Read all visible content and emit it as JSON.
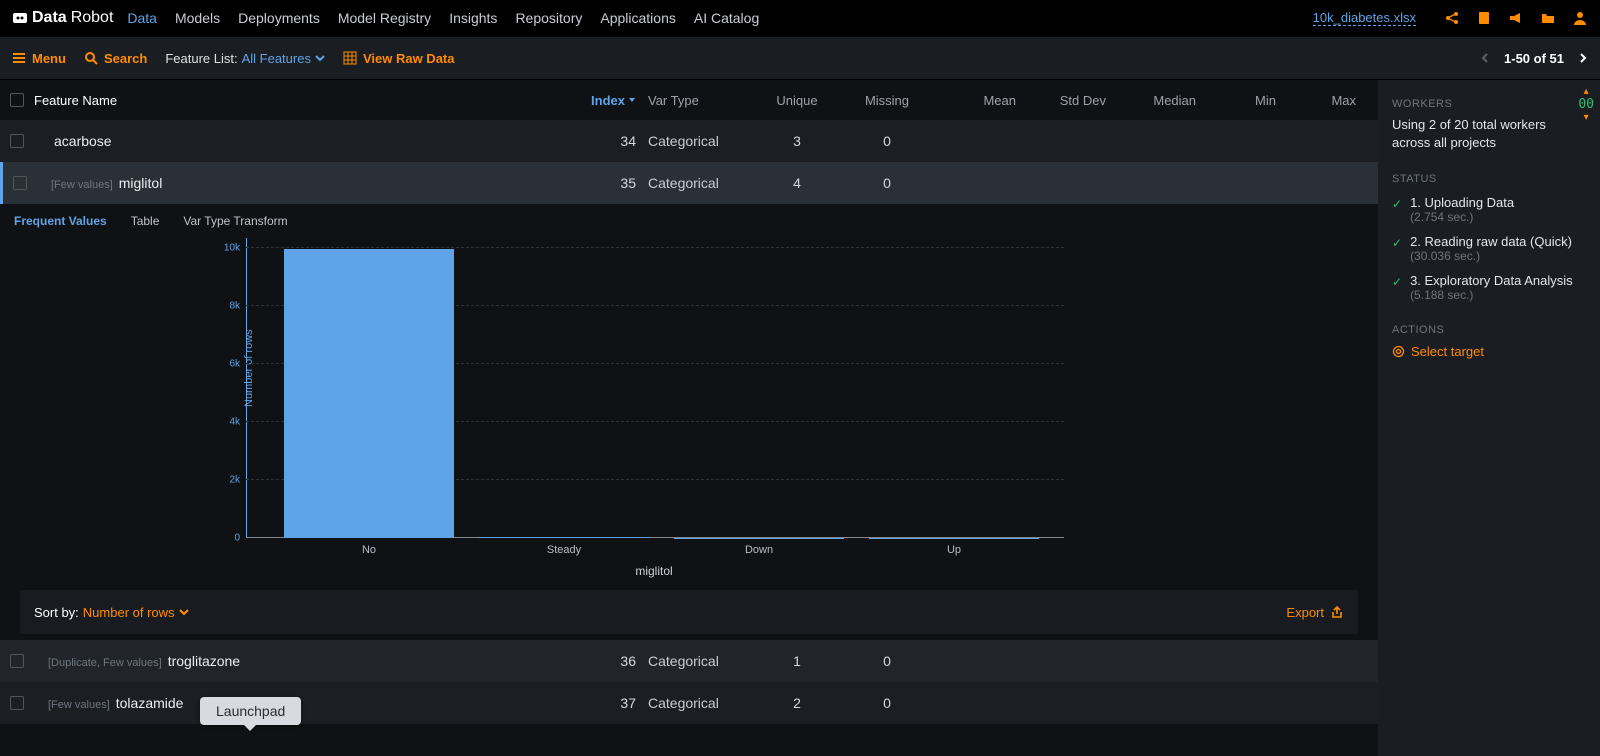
{
  "topnav": {
    "logo_bold": "Data",
    "logo_thin": "Robot",
    "items": [
      "Data",
      "Models",
      "Deployments",
      "Model Registry",
      "Insights",
      "Repository",
      "Applications",
      "AI Catalog"
    ],
    "project_link": "10k_diabetes.xlsx"
  },
  "subnav": {
    "menu": "Menu",
    "search": "Search",
    "feature_list_label": "Feature List:",
    "feature_list_value": "All Features",
    "view_raw": "View Raw Data",
    "pager": "1-50 of 51"
  },
  "columns": {
    "name": "Feature Name",
    "index": "Index",
    "vartype": "Var Type",
    "unique": "Unique",
    "missing": "Missing",
    "mean": "Mean",
    "stddev": "Std Dev",
    "median": "Median",
    "min": "Min",
    "max": "Max"
  },
  "rows": [
    {
      "tags": "",
      "name": "acarbose",
      "index": "34",
      "vartype": "Categorical",
      "unique": "3",
      "missing": "0"
    },
    {
      "tags": "[Few values]",
      "name": "miglitol",
      "index": "35",
      "vartype": "Categorical",
      "unique": "4",
      "missing": "0"
    },
    {
      "tags": "[Duplicate, Few values]",
      "name": "troglitazone",
      "index": "36",
      "vartype": "Categorical",
      "unique": "1",
      "missing": "0"
    },
    {
      "tags": "[Few values]",
      "name": "tolazamide",
      "index": "37",
      "vartype": "Categorical",
      "unique": "2",
      "missing": "0"
    }
  ],
  "expanded": {
    "tabs": [
      "Frequent Values",
      "Table",
      "Var Type Transform"
    ],
    "y_label": "Number of rows",
    "x_label": "miglitol"
  },
  "chart_data": {
    "type": "bar",
    "title": "",
    "xlabel": "miglitol",
    "ylabel": "Number of rows",
    "categories": [
      "No",
      "Steady",
      "Down",
      "Up"
    ],
    "values": [
      9950,
      30,
      10,
      10
    ],
    "ylim": [
      0,
      10000
    ],
    "yticks": [
      "0",
      "2k",
      "4k",
      "6k",
      "8k",
      "10k"
    ]
  },
  "sortbar": {
    "label": "Sort by:",
    "value": "Number of rows",
    "export": "Export"
  },
  "sidebar": {
    "workers_h": "Workers",
    "workers_text": "Using 2 of 20 total workers across all projects",
    "counter": "00",
    "status_h": "Status",
    "status": [
      {
        "title": "1. Uploading Data",
        "sub": "(2.754 sec.)"
      },
      {
        "title": "2. Reading raw data (Quick)",
        "sub": "(30.036 sec.)"
      },
      {
        "title": "3. Exploratory Data Analysis",
        "sub": "(5.188 sec.)"
      }
    ],
    "actions_h": "Actions",
    "action_link": "Select target"
  },
  "tooltip": "Launchpad"
}
